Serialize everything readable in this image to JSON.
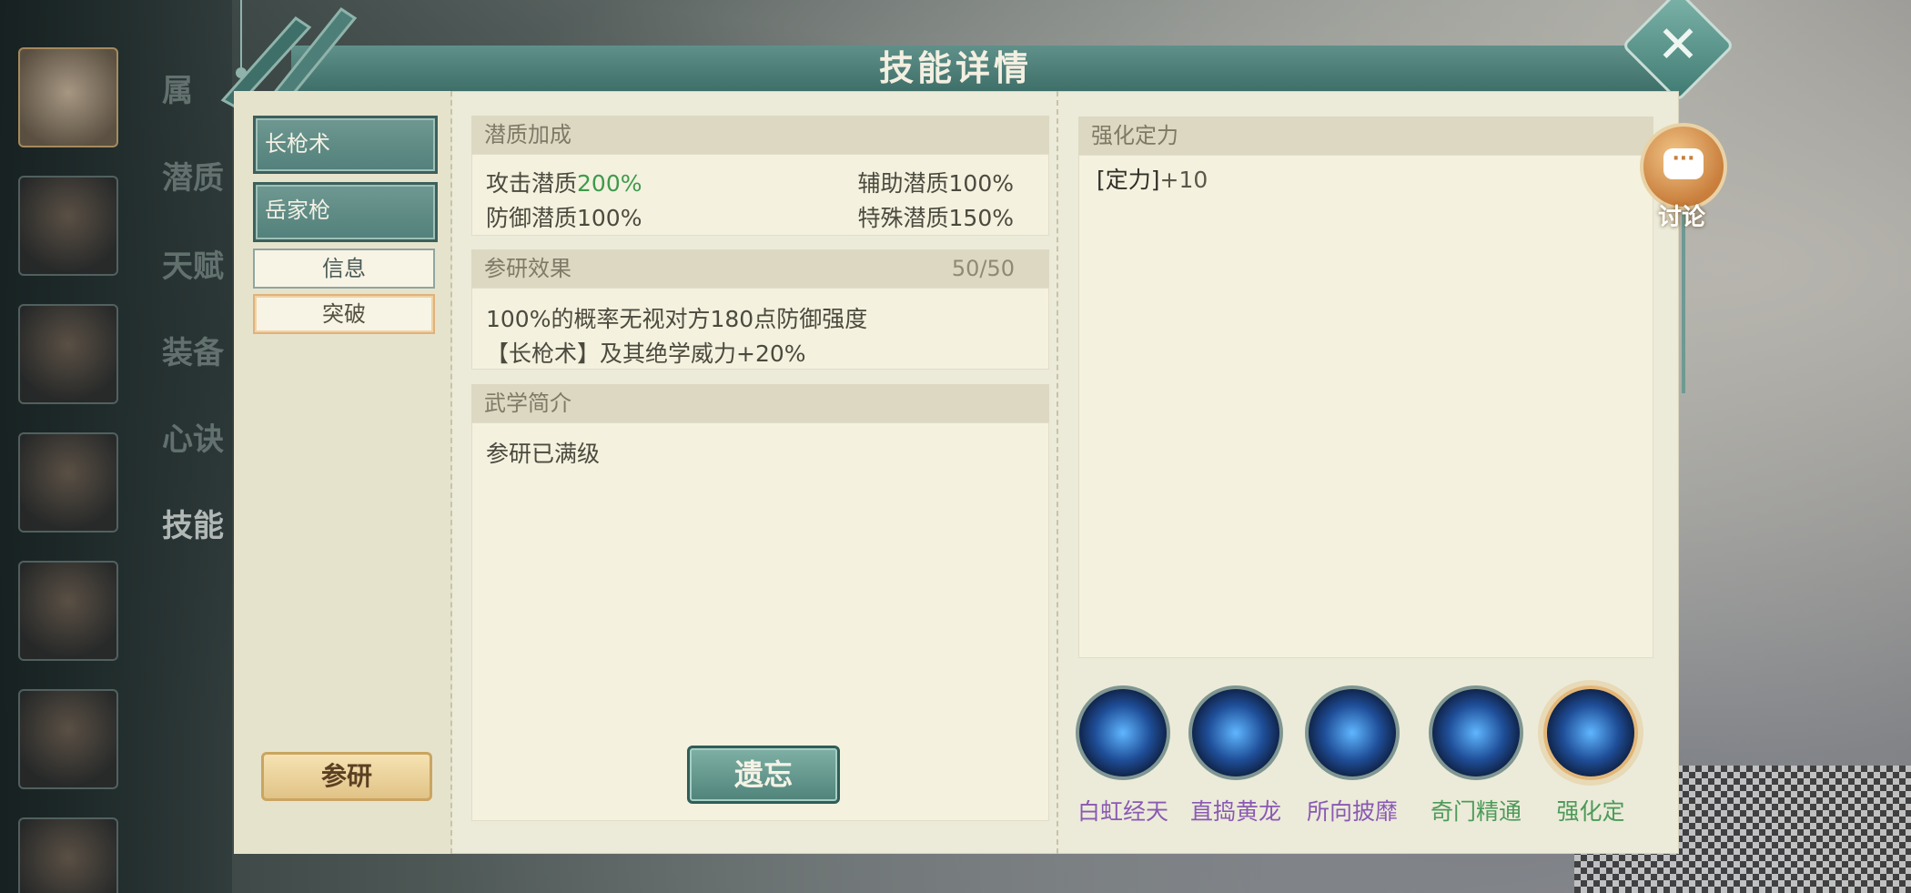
{
  "window": {
    "title": "技能详情",
    "close_icon": "close-icon"
  },
  "side_menu": [
    "属",
    "潜质",
    "天赋",
    "装备",
    "心诀",
    "技能"
  ],
  "skill_tabs": [
    {
      "label": "长枪术"
    },
    {
      "label": "岳家枪"
    }
  ],
  "sub_tabs": [
    {
      "label": "信息"
    },
    {
      "label": "突破"
    }
  ],
  "research_button": "参研",
  "aptitude": {
    "header": "潜质加成",
    "attack_label": "攻击潜质",
    "attack_value": "200%",
    "support": "辅助潜质100%",
    "defense": "防御潜质100%",
    "special": "特殊潜质150%"
  },
  "research_effect": {
    "header": "参研效果",
    "count": "50/50",
    "line1": "100%的概率无视对方180点防御强度",
    "line2": "【长枪术】及其绝学威力+20%"
  },
  "intro": {
    "header": "武学简介",
    "text": "参研已满级"
  },
  "forget_button": "遗忘",
  "enhance": {
    "header": "强化定力",
    "text_label": "[定力]",
    "text_value": "+10"
  },
  "skills": [
    {
      "name": "白虹经天",
      "color": "#8a5ab3"
    },
    {
      "name": "直捣黄龙",
      "color": "#8a5ab3"
    },
    {
      "name": "所向披靡",
      "color": "#8a5ab3"
    },
    {
      "name": "奇门精通",
      "color": "#4e9a5a"
    },
    {
      "name": "强化定",
      "color": "#4e9a5a"
    }
  ],
  "discuss": {
    "label": "讨论",
    "icon": "chat-bubble-icon"
  },
  "colors": {
    "accent": "#52807a",
    "panel": "#ecebd9",
    "gold": "#e1c387"
  }
}
